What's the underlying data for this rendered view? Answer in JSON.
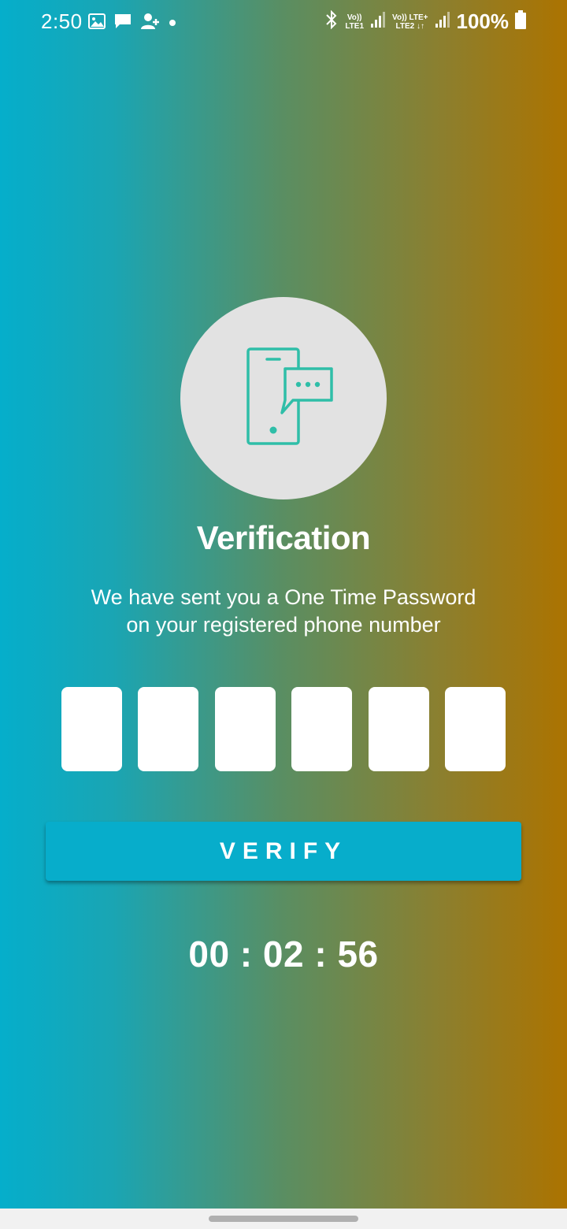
{
  "status_bar": {
    "time": "2:50",
    "left_icons": [
      "image-icon",
      "message-icon",
      "person-add-icon",
      "dot-icon"
    ],
    "right_icons": [
      "bluetooth-icon",
      "signal-icon",
      "signal-icon"
    ],
    "sim1_label_top": "Vo))",
    "sim1_label_bottom": "LTE1",
    "sim2_label_top": "Vo)) LTE+",
    "sim2_label_bottom": "LTE2 ↓↑",
    "battery": "100%"
  },
  "hero": {
    "icon": "phone-message-icon",
    "circle_color": "#e2e2e2",
    "icon_color": "#2fbea8"
  },
  "title": "Verification",
  "subtitle": {
    "line1": "We have sent you a One Time Password",
    "line2": "on your registered phone number"
  },
  "otp": {
    "digits": [
      "",
      "",
      "",
      "",
      "",
      ""
    ]
  },
  "verify_button": {
    "label": "VERIFY",
    "color": "#07adcb"
  },
  "timer": "00 : 02 : 56",
  "colors": {
    "gradient_start": "#05aecb",
    "gradient_end": "#ac7300"
  }
}
